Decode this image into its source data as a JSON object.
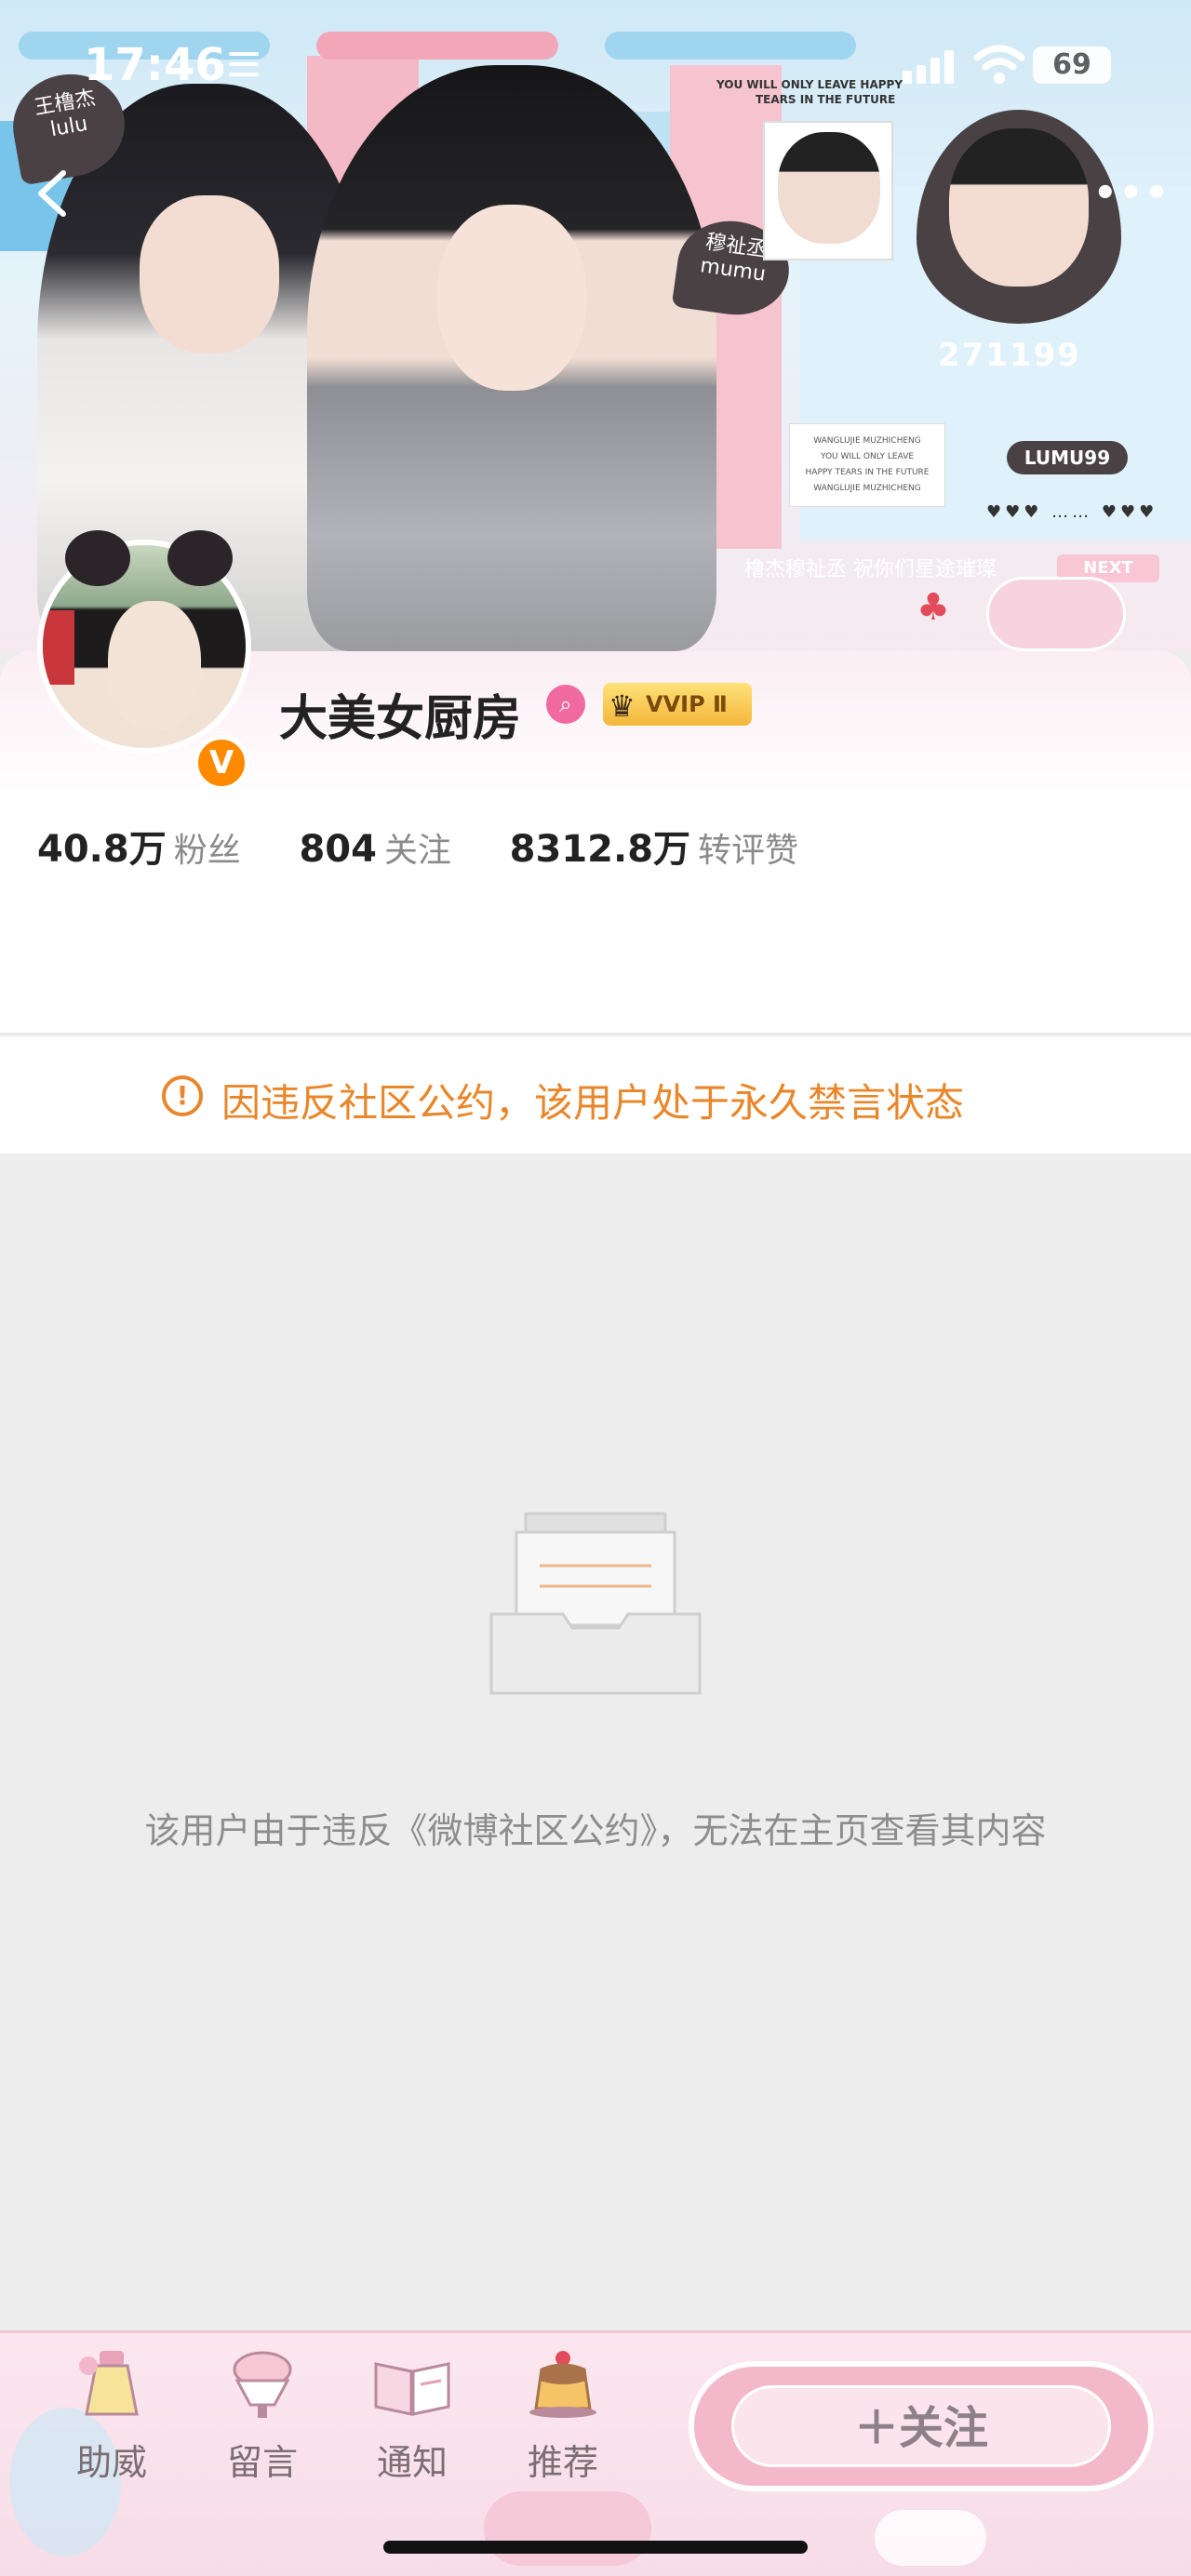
{
  "status_bar": {
    "time": "17:46",
    "battery": "69"
  },
  "banner": {
    "sticker_left_line1": "王橹杰",
    "sticker_left_line2": "lulu",
    "sticker_right_line1": "穆祉丞",
    "sticker_right_line2": "mumu",
    "tagline_line1": "YOU WILL ONLY LEAVE HAPPY",
    "tagline_line2": "TEARS IN THE FUTURE",
    "number": "271199",
    "note_lines": [
      "WANGLUJIE MUZHICHENG",
      "YOU WILL ONLY LEAVE",
      "HAPPY TEARS IN THE FUTURE",
      "WANGLUJIE MUZHICHENG"
    ],
    "badge": "LUMU99",
    "next": "NEXT",
    "blessing": "橹杰穆祉丞 祝你们星途璀璨"
  },
  "profile": {
    "name": "大美女厨房",
    "vip_label": "VVIP Ⅱ",
    "verified_mark": "V",
    "stats": [
      {
        "value": "40.8万",
        "label": "粉丝"
      },
      {
        "value": "804",
        "label": "关注"
      },
      {
        "value": "8312.8万",
        "label": "转评赞"
      }
    ]
  },
  "notice": {
    "icon": "!",
    "text": "因违反社区公约，该用户处于永久禁言状态"
  },
  "empty_state": {
    "text": "该用户由于违反《微博社区公约》，无法在主页查看其内容"
  },
  "bottom_bar": {
    "tabs": [
      {
        "label": "助威",
        "icon": "bottle-icon"
      },
      {
        "label": "留言",
        "icon": "dessert-cup-icon"
      },
      {
        "label": "通知",
        "icon": "book-icon"
      },
      {
        "label": "推荐",
        "icon": "pudding-icon"
      }
    ],
    "follow_label": "＋关注"
  },
  "colors": {
    "notice_orange": "#e9862a",
    "vip_gold": "#f3b63a",
    "verified_orange": "#ff8a00",
    "bottom_pink": "#f3b9cb"
  }
}
